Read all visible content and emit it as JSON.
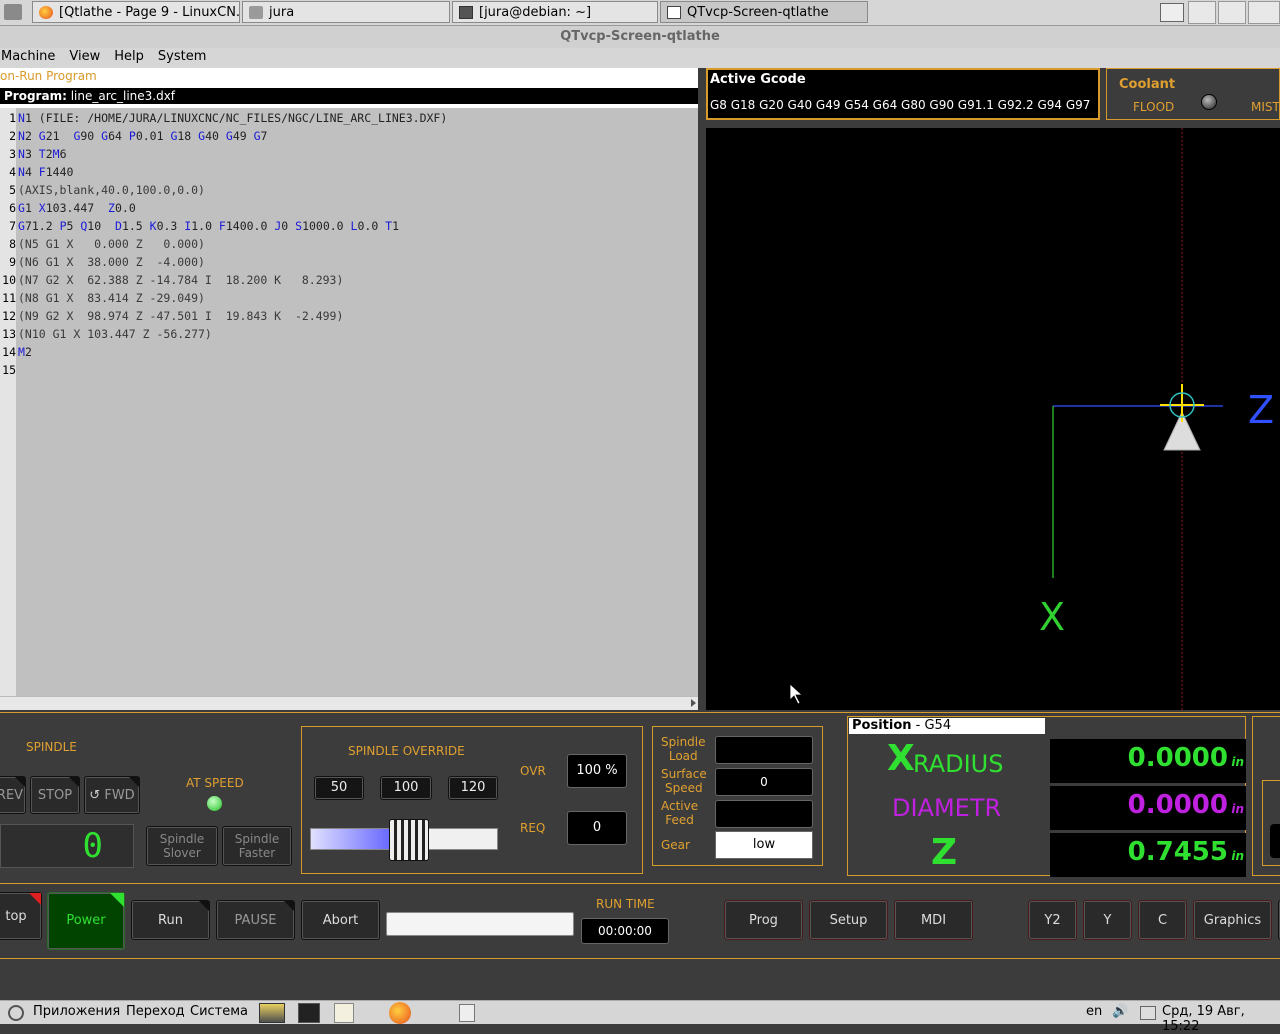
{
  "taskbar": {
    "tabs": [
      {
        "label": "[Qtlathe - Page 9 - LinuxCN..."
      },
      {
        "label": "jura"
      },
      {
        "label": "[jura@debian: ~]"
      },
      {
        "label": "QTvcp-Screen-qtlathe"
      }
    ]
  },
  "window": {
    "title": "QTvcp-Screen-qtlathe"
  },
  "menu": {
    "items": [
      "Machine",
      "View",
      "Help",
      "System"
    ]
  },
  "editor": {
    "mode_label": "on-Run Program",
    "program_label": "Program:",
    "program_file": "line_arc_line3.dxf",
    "lines": [
      "N1 (FILE: /HOME/JURA/LINUXCNC/NC_FILES/NGC/LINE_ARC_LINE3.DXF)",
      "N2 G21  G90 G64 P0.01 G18 G40 G49 G7",
      "N3 T2M6",
      "N4 F1440",
      "(AXIS,blank,40.0,100.0,0.0)",
      "G1 X103.447  Z0.0",
      "G71.2 P5 Q10  D1.5 K0.3 I1.0 F1400.0 J0 S1000.0 L0.0 T1",
      "(N5 G1 X   0.000 Z   0.000)",
      "(N6 G1 X  38.000 Z  -4.000)",
      "(N7 G2 X  62.388 Z -14.784 I  18.200 K   8.293)",
      "(N8 G1 X  83.414 Z -29.049)",
      "(N9 G2 X  98.974 Z -47.501 I  19.843 K  -2.499)",
      "(N10 G1 X 103.447 Z -56.277)",
      "M2",
      ""
    ],
    "line_numbers": [
      "1",
      "2",
      "3",
      "4",
      "5",
      "6",
      "7",
      "8",
      "9",
      "10",
      "11",
      "12",
      "13",
      "14",
      "15"
    ]
  },
  "active_gcode": {
    "title": "Active Gcode",
    "codes": "G8 G18 G20 G40 G49 G54 G64 G80 G90 G91.1 G92.2 G94 G97"
  },
  "coolant": {
    "title": "Coolant",
    "flood": "FLOOD",
    "mist": "MIST"
  },
  "graphics": {
    "axis_z": "Z",
    "axis_x": "X"
  },
  "spindle": {
    "title": "SPINDLE",
    "rev": "REV",
    "stop": "STOP",
    "fwd": "FWD",
    "at_speed": "AT SPEED",
    "rpm_display": "0",
    "slower_1": "Spindle",
    "slower_2": "Slover",
    "faster_1": "Spindle",
    "faster_2": "Faster"
  },
  "spindle_override": {
    "title": "SPINDLE OVERRIDE",
    "presets": [
      "50",
      "100",
      "120"
    ],
    "ovr_label": "OVR",
    "ovr_value": "100 %",
    "req_label": "REQ",
    "req_value": "0",
    "slider_fraction": 0.4
  },
  "spindle_info": {
    "load_label_1": "Spindle",
    "load_label_2": "Load",
    "load_value": "",
    "surface_label_1": "Surface",
    "surface_label_2": "Speed",
    "surface_value": "0",
    "feed_label_1": "Active",
    "feed_label_2": "Feed",
    "feed_value": "",
    "gear_label": "Gear",
    "gear_value": "low"
  },
  "position": {
    "title": "Position",
    "offset": "- G54",
    "x_letter": "X",
    "x_label": "RADIUS",
    "x_value": "0.0000",
    "x_unit": "in",
    "d_label": "DIAMETR",
    "d_value": "0.0000",
    "d_unit": "in",
    "z_letter": "Z",
    "z_value": "0.7455",
    "z_unit": "in"
  },
  "controls": {
    "estop": "top",
    "power": "Power",
    "run": "Run",
    "pause": "PAUSE",
    "abort": "Abort",
    "run_time_label": "RUN TIME",
    "run_time_value": "00:00:00",
    "prog": "Prog",
    "setup": "Setup",
    "mdi": "MDI",
    "y2": "Y2",
    "y": "Y",
    "c": "C",
    "graphics": "Graphics"
  },
  "bottom_taskbar": {
    "apps": "Приложения",
    "go": "Переход",
    "system": "Система",
    "lang": "en",
    "clock": "Срд, 19 Авг, 15:22"
  },
  "colors": {
    "accent": "#d89a2a",
    "green": "#3fe03f",
    "magenta": "#c020e0",
    "gcode_blue": "#1a1ad8"
  }
}
